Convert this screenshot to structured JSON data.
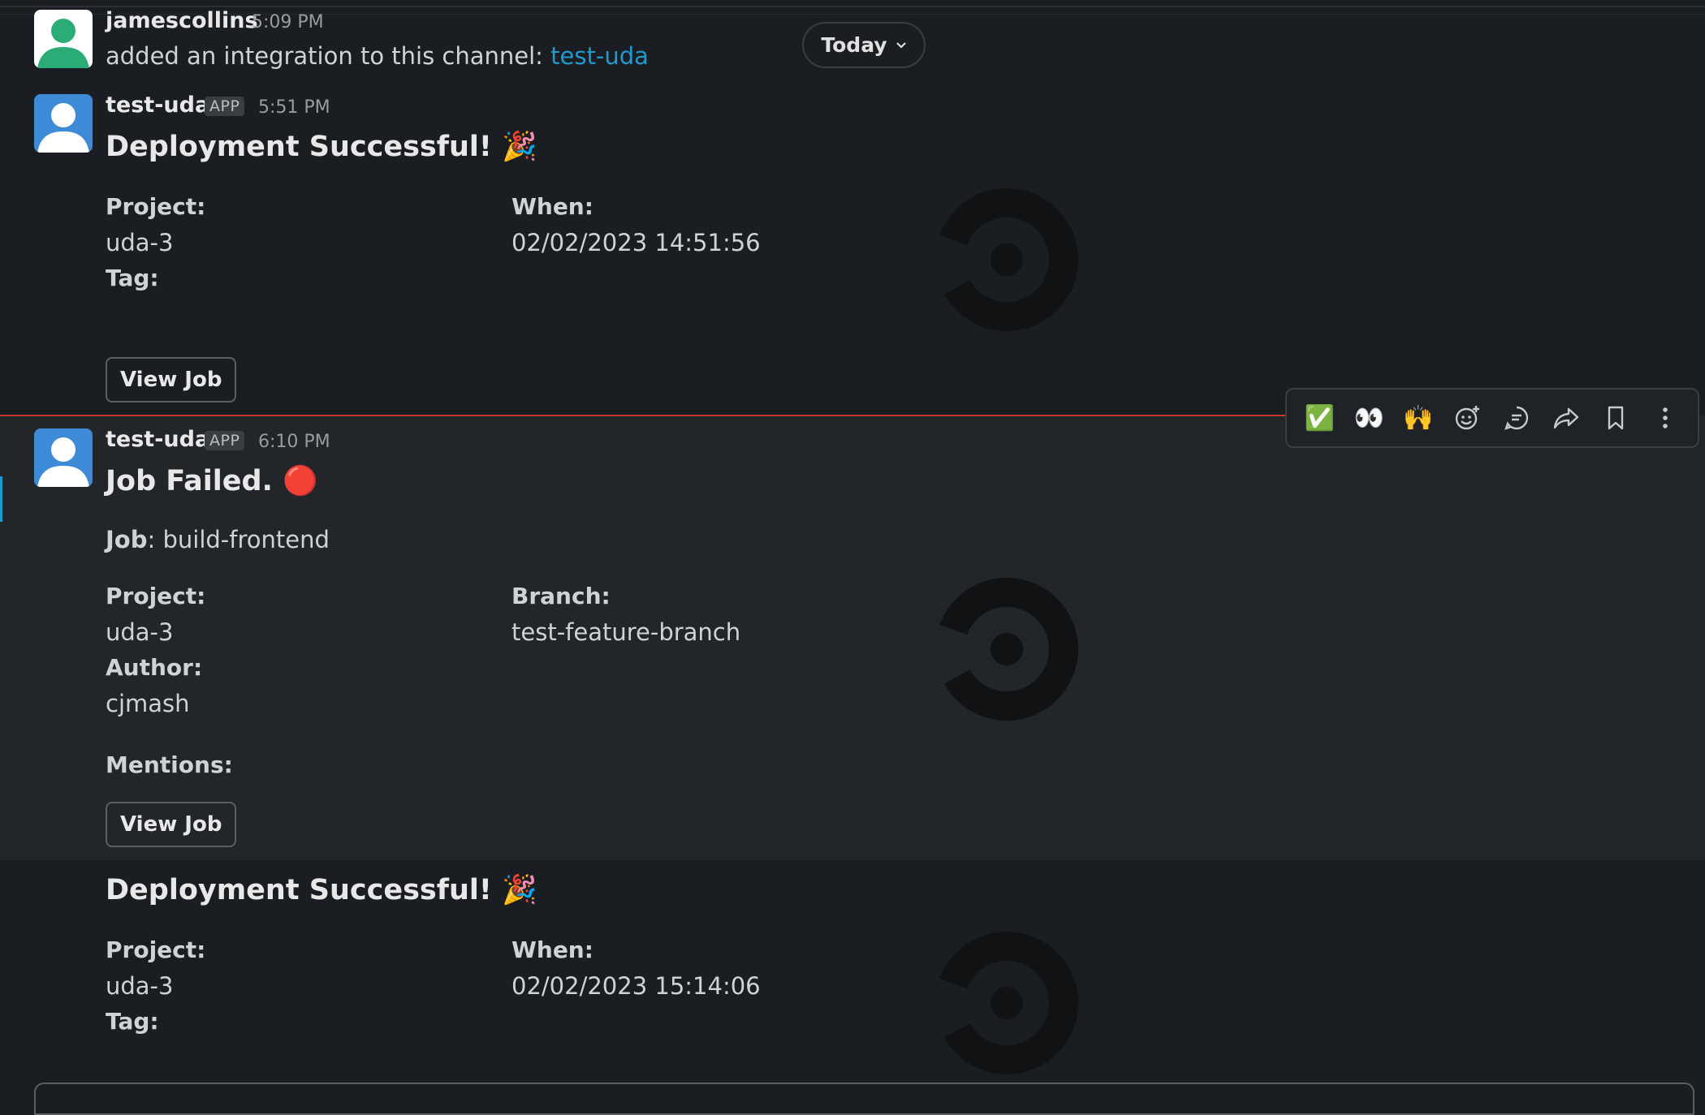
{
  "colors": {
    "background": "#1a1d21",
    "link": "#1d9bd1",
    "new_divider": "#c0392b",
    "avatar_green": "#2bac76",
    "avatar_blue": "#3d8bd6"
  },
  "date_divider": {
    "label": "Today",
    "icon": "chevron-down-icon"
  },
  "messages": [
    {
      "author": "jamescollins",
      "time": "5:09 PM",
      "text_prefix": "added an integration to this channel: ",
      "link_text": "test-uda"
    },
    {
      "author": "test-uda",
      "badge": "APP",
      "time": "5:51 PM",
      "heading": "Deployment Successful!",
      "heading_emoji": "🎉",
      "fields_left": [
        {
          "label": "Project:",
          "value": "uda-3"
        },
        {
          "label": "Tag:",
          "value": ""
        }
      ],
      "fields_right": [
        {
          "label": "When:",
          "value": "02/02/2023 14:51:56"
        }
      ],
      "button": "View Job"
    },
    {
      "author": "test-uda",
      "badge": "APP",
      "time": "6:10 PM",
      "heading": "Job Failed.",
      "heading_emoji": "🔴",
      "job_label": "Job",
      "job_value": ": build-frontend",
      "fields_left": [
        {
          "label": "Project:",
          "value": "uda-3"
        },
        {
          "label": "Author:",
          "value": "cjmash"
        }
      ],
      "fields_right": [
        {
          "label": "Branch:",
          "value": "test-feature-branch"
        }
      ],
      "mentions_label": "Mentions:",
      "button": "View Job"
    },
    {
      "heading": "Deployment Successful!",
      "heading_emoji": "🎉",
      "fields_left": [
        {
          "label": "Project:",
          "value": "uda-3"
        },
        {
          "label": "Tag:",
          "value": ""
        }
      ],
      "fields_right": [
        {
          "label": "When:",
          "value": "02/02/2023 15:14:06"
        }
      ]
    }
  ],
  "toolbar": {
    "items": [
      {
        "icon": "white-check-mark-emoji",
        "glyph": "✅"
      },
      {
        "icon": "eyes-emoji",
        "glyph": "👀"
      },
      {
        "icon": "raised-hands-emoji",
        "glyph": "🙌"
      },
      {
        "icon": "add-reaction-icon"
      },
      {
        "icon": "reply-in-thread-icon"
      },
      {
        "icon": "share-icon"
      },
      {
        "icon": "bookmark-icon"
      },
      {
        "icon": "more-actions-icon"
      }
    ]
  }
}
